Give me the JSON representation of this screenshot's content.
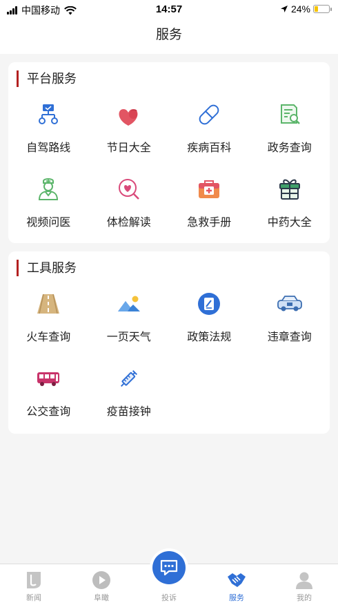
{
  "status": {
    "carrier": "中国移动",
    "time": "14:57",
    "battery": "24%",
    "battery_level": 0.24
  },
  "nav": {
    "title": "服务"
  },
  "platform": {
    "title": "平台服务",
    "items": [
      {
        "label": "自驾路线",
        "icon": "route-icon"
      },
      {
        "label": "节日大全",
        "icon": "hearts-icon"
      },
      {
        "label": "疾病百科",
        "icon": "pill-icon"
      },
      {
        "label": "政务查询",
        "icon": "document-search-icon"
      },
      {
        "label": "视频问医",
        "icon": "doctor-icon"
      },
      {
        "label": "体检解读",
        "icon": "heart-search-icon"
      },
      {
        "label": "急救手册",
        "icon": "first-aid-kit-icon"
      },
      {
        "label": "中药大全",
        "icon": "gift-box-icon"
      }
    ]
  },
  "tools": {
    "title": "工具服务",
    "items": [
      {
        "label": "火车查询",
        "icon": "railway-icon"
      },
      {
        "label": "一页天气",
        "icon": "weather-landscape-icon"
      },
      {
        "label": "政策法规",
        "icon": "policy-icon"
      },
      {
        "label": "违章查询",
        "icon": "car-violation-icon"
      },
      {
        "label": "公交查询",
        "icon": "bus-icon"
      },
      {
        "label": "疫苗接钟",
        "icon": "syringe-icon"
      }
    ]
  },
  "tabbar": {
    "items": [
      {
        "label": "新闻",
        "icon": "news-icon"
      },
      {
        "label": "阜瞰",
        "icon": "play-icon"
      },
      {
        "label": "投诉",
        "icon": "chat-icon"
      },
      {
        "label": "服务",
        "icon": "handshake-icon"
      },
      {
        "label": "我的",
        "icon": "user-icon"
      }
    ],
    "active_index": 3
  },
  "colors": {
    "accent": "#2f6fd6",
    "section_marker": "#b32020"
  }
}
